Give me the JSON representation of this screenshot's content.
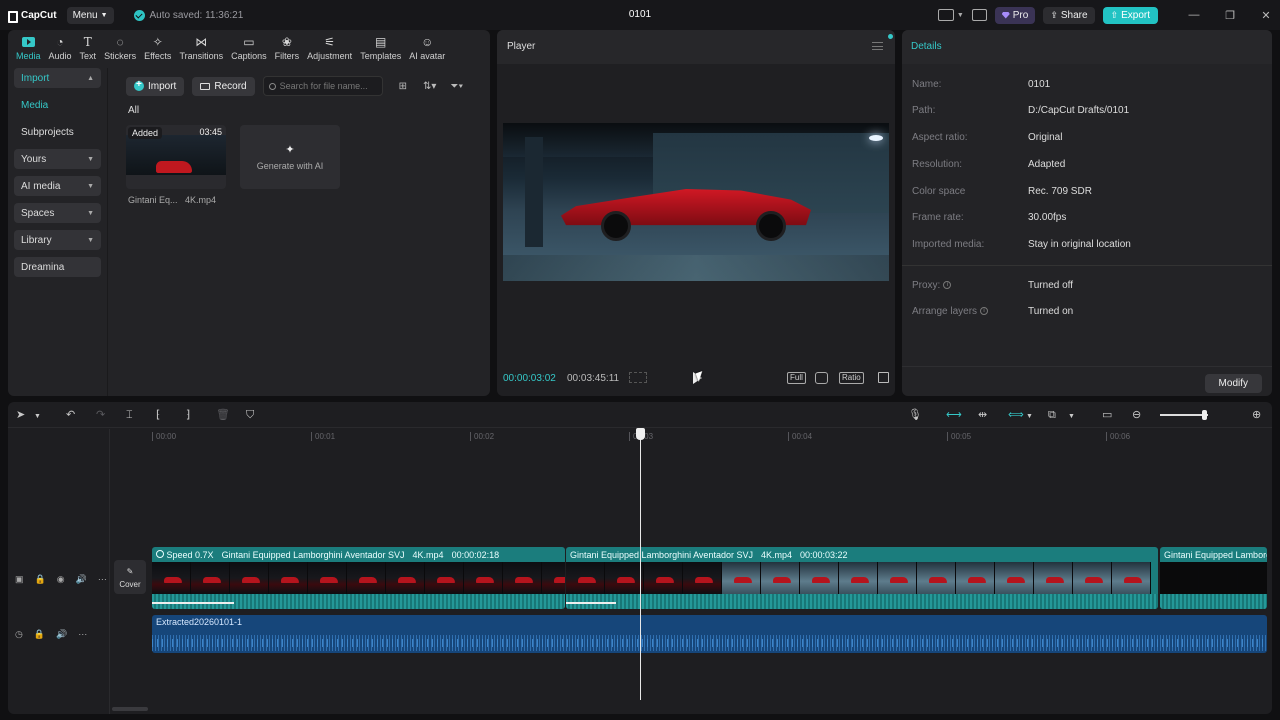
{
  "app": {
    "logo": "CapCut",
    "menu_label": "Menu",
    "autosave": "Auto saved: 11:36:21",
    "project_title": "0101",
    "pro_label": "Pro",
    "share_label": "Share",
    "export_label": "Export"
  },
  "tools": [
    {
      "label": "Media",
      "icon": "media-icon"
    },
    {
      "label": "Audio",
      "icon": "audio-icon"
    },
    {
      "label": "Text",
      "icon": "text-icon"
    },
    {
      "label": "Stickers",
      "icon": "stickers-icon"
    },
    {
      "label": "Effects",
      "icon": "effects-icon"
    },
    {
      "label": "Transitions",
      "icon": "transitions-icon"
    },
    {
      "label": "Captions",
      "icon": "captions-icon"
    },
    {
      "label": "Filters",
      "icon": "filters-icon"
    },
    {
      "label": "Adjustment",
      "icon": "adjustment-icon"
    },
    {
      "label": "Templates",
      "icon": "templates-icon"
    },
    {
      "label": "AI avatar",
      "icon": "ai-avatar-icon"
    }
  ],
  "sidenav": [
    "Import",
    "Media",
    "Subprojects",
    "Yours",
    "AI media",
    "Spaces",
    "Library",
    "Dreamina"
  ],
  "media": {
    "import_btn": "Import",
    "record_btn": "Record",
    "search_placeholder": "Search for file name...",
    "all_label": "All",
    "thumb_added": "Added",
    "thumb_duration": "03:45",
    "thumb_name": "Gintani Eq...   4K.mp4",
    "generate_ai": "Generate with AI"
  },
  "player": {
    "title": "Player",
    "current_time": "00:00:03:02",
    "total_time": "00:03:45:11",
    "full_label": "Full",
    "ratio_label": "Ratio"
  },
  "details": {
    "title": "Details",
    "rows": [
      {
        "label": "Name:",
        "value": "0101"
      },
      {
        "label": "Path:",
        "value": "D:/CapCut Drafts/0101"
      },
      {
        "label": "Aspect ratio:",
        "value": "Original"
      },
      {
        "label": "Resolution:",
        "value": "Adapted"
      },
      {
        "label": "Color space",
        "value": "Rec. 709 SDR"
      },
      {
        "label": "Frame rate:",
        "value": "30.00fps"
      },
      {
        "label": "Imported media:",
        "value": "Stay in original location"
      }
    ],
    "proxy_label": "Proxy:",
    "proxy_value": "Turned off",
    "arrange_label": "Arrange layers",
    "arrange_value": "Turned on",
    "modify_btn": "Modify"
  },
  "timeline": {
    "ruler": [
      "00:00",
      "00:01",
      "00:02",
      "00:03",
      "00:04",
      "00:05",
      "00:06"
    ],
    "cover_label": "Cover",
    "clip1": {
      "speed": "Speed 0.7X",
      "name": "Gintani Equipped Lamborghini Aventador SVJ",
      "file": "4K.mp4",
      "duration": "00:00:02:18"
    },
    "clip2": {
      "name": "Gintani Equipped Lamborghini Aventador SVJ",
      "file": "4K.mp4",
      "duration": "00:00:03:22"
    },
    "clip3": {
      "name": "Gintani Equipped Lamborghi"
    },
    "audio_label": "Extracted20260101-1"
  },
  "colors": {
    "accent": "#35c8c8",
    "clip": "#1b7d7d",
    "audio": "#16467a"
  }
}
